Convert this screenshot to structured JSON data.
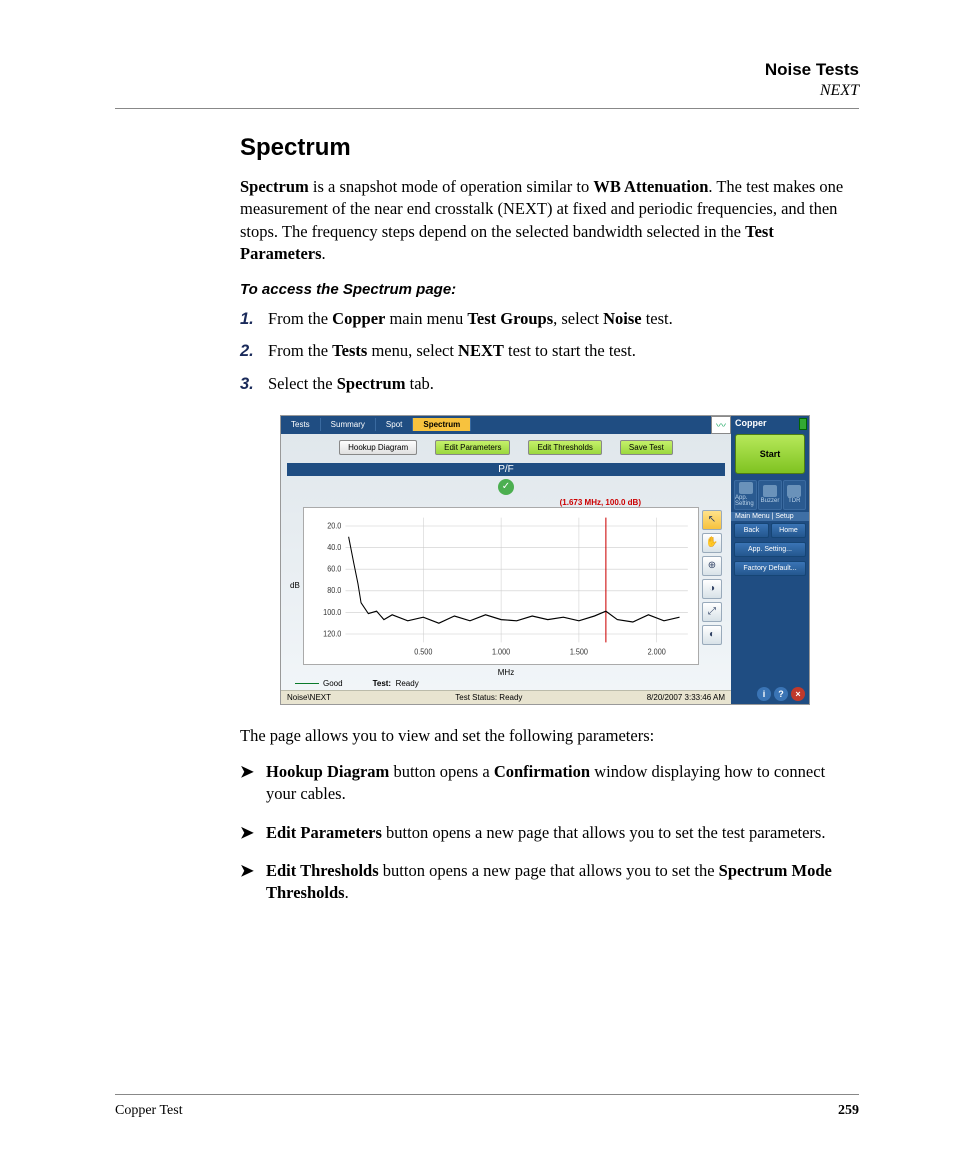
{
  "header": {
    "title": "Noise Tests",
    "subtitle": "NEXT"
  },
  "section": {
    "title": "Spectrum",
    "intro_parts": {
      "t1": "Spectrum",
      "t2": " is a snapshot mode of operation similar to ",
      "t3": "WB Attenuation",
      "t4": ". The test makes one measurement of the near end crosstalk (NEXT) at fixed and periodic frequencies, and then stops. The frequency steps depend on the selected bandwidth selected in the ",
      "t5": "Test Parameters",
      "t6": "."
    },
    "sub_heading": "To access the Spectrum page:",
    "steps": [
      {
        "num": "1.",
        "pre": "From the ",
        "b1": "Copper",
        "mid": " main menu ",
        "b2": "Test Groups",
        "mid2": ", select ",
        "b3": "Noise",
        "post": " test."
      },
      {
        "num": "2.",
        "pre": "From the ",
        "b1": "Tests",
        "mid": " menu, select ",
        "b2": "NEXT",
        "mid2": " test to start the test.",
        "b3": "",
        "post": ""
      },
      {
        "num": "3.",
        "pre": "Select the ",
        "b1": "Spectrum",
        "mid": " tab.",
        "b2": "",
        "mid2": "",
        "b3": "",
        "post": ""
      }
    ],
    "after_figure": "The page allows you to view and set the following parameters:",
    "bullets": [
      {
        "b1": "Hookup Diagram",
        "t1": " button opens a ",
        "b2": "Confirmation",
        "t2": " window displaying how to connect your cables."
      },
      {
        "b1": "Edit Parameters",
        "t1": " button opens a new page that allows you to set the test parameters.",
        "b2": "",
        "t2": ""
      },
      {
        "b1": "Edit Thresholds",
        "t1": " button opens a new page that allows you to set the ",
        "b2": "Spectrum Mode Thresholds",
        "t2": "."
      }
    ]
  },
  "screenshot": {
    "tabs": [
      "Tests",
      "Summary",
      "Spot",
      "Spectrum"
    ],
    "active_tab": 3,
    "toolbar": {
      "hookup": "Hookup Diagram",
      "edit_params": "Edit Parameters",
      "edit_thresh": "Edit Thresholds",
      "save": "Save Test"
    },
    "pf_label": "P/F",
    "cursor_label": "(1.673 MHz, 100.0 dB)",
    "ylabel": "dB",
    "xlabel": "MHz",
    "yticks": [
      "20.0",
      "40.0",
      "60.0",
      "80.0",
      "100.0",
      "120.0"
    ],
    "xticks": [
      "0.500",
      "1.000",
      "1.500",
      "2.000"
    ],
    "legend_good": "Good",
    "legend_test": "Test:",
    "legend_ready": "Ready",
    "status_left": "Noise\\NEXT",
    "status_mid": "Test Status: Ready",
    "status_right": "8/20/2007 3:33:46 AM",
    "side": {
      "brand": "Copper",
      "start": "Start",
      "icons": [
        "App. Setting",
        "Buzzer",
        "TDR"
      ],
      "menu_header": "Main Menu | Setup",
      "back": "Back",
      "home": "Home",
      "app_setting": "App. Setting...",
      "factory": "Factory Default..."
    }
  },
  "chart_data": {
    "type": "line",
    "title": "",
    "xlabel": "MHz",
    "ylabel": "dB",
    "xlim": [
      0,
      2.2
    ],
    "ylim": [
      130,
      10
    ],
    "xticks": [
      0.5,
      1.0,
      1.5,
      2.0
    ],
    "yticks": [
      20,
      40,
      60,
      80,
      100,
      120
    ],
    "cursor": {
      "x": 1.673,
      "y": 100.0
    },
    "series": [
      {
        "name": "NEXT",
        "color": "#000000",
        "x": [
          0.02,
          0.05,
          0.08,
          0.1,
          0.15,
          0.2,
          0.25,
          0.3,
          0.4,
          0.5,
          0.6,
          0.7,
          0.8,
          0.9,
          1.0,
          1.1,
          1.2,
          1.3,
          1.4,
          1.5,
          1.6,
          1.673,
          1.75,
          1.85,
          1.95,
          2.05,
          2.15
        ],
        "y": [
          30,
          55,
          75,
          92,
          102,
          100,
          108,
          104,
          110,
          106,
          112,
          105,
          110,
          104,
          108,
          110,
          105,
          109,
          106,
          110,
          105,
          100,
          108,
          111,
          104,
          110,
          106
        ]
      }
    ]
  },
  "footer": {
    "left": "Copper Test",
    "page": "259"
  }
}
